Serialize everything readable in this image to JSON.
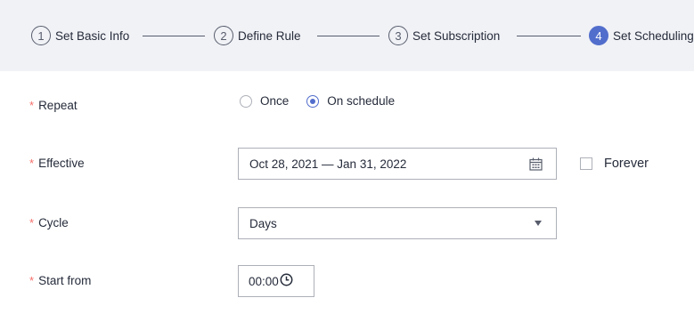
{
  "steps": [
    {
      "num": "1",
      "label": "Set Basic Info",
      "active": false
    },
    {
      "num": "2",
      "label": "Define Rule",
      "active": false
    },
    {
      "num": "3",
      "label": "Set Subscription",
      "active": false
    },
    {
      "num": "4",
      "label": "Set Scheduling",
      "active": true
    }
  ],
  "form": {
    "required_mark": "*",
    "repeat": {
      "label": "Repeat",
      "options": [
        "Once",
        "On schedule"
      ],
      "selected": "On schedule"
    },
    "effective": {
      "label": "Effective",
      "value": "Oct 28, 2021 — Jan 31, 2022",
      "icon": "calendar-icon",
      "forever_label": "Forever",
      "forever_checked": false
    },
    "cycle": {
      "label": "Cycle",
      "value": "Days",
      "icon": "chevron-down-icon"
    },
    "start_from": {
      "label": "Start from",
      "value": "00:00",
      "icon": "clock-icon"
    }
  },
  "colors": {
    "accent": "#526ecc",
    "required": "#f66f6a",
    "stepper_bg": "#f1f2f6"
  }
}
